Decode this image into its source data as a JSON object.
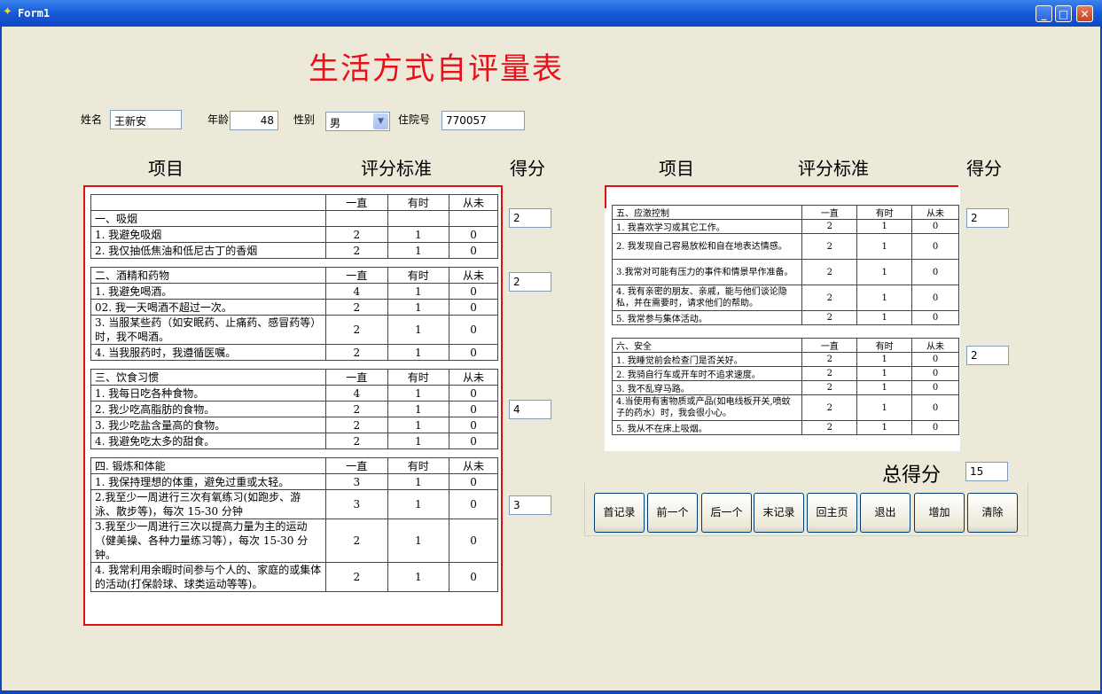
{
  "window": {
    "title": "Form1"
  },
  "form": {
    "heading": "生活方式自评量表",
    "name_label": "姓名",
    "name_value": "王新安",
    "age_label": "年龄",
    "age_value": "48",
    "gender_label": "性别",
    "gender_value": "男",
    "admission_label": "住院号",
    "admission_value": "770057"
  },
  "columns": {
    "item": "项目",
    "criteria": "评分标准",
    "score": "得分"
  },
  "scale_headers": {
    "always": "一直",
    "sometimes": "有时",
    "never": "从未"
  },
  "sections_left": [
    {
      "title": "一、吸烟",
      "score": "2",
      "items": [
        {
          "text": "1. 我避免吸烟",
          "v": [
            "2",
            "1",
            "0"
          ]
        },
        {
          "text": "2. 我仅抽低焦油和低尼古丁的香烟",
          "v": [
            "2",
            "1",
            "0"
          ]
        }
      ]
    },
    {
      "title": "二、酒精和药物",
      "score": "2",
      "items": [
        {
          "text": "1. 我避免喝酒。",
          "v": [
            "4",
            "1",
            "0"
          ]
        },
        {
          "text": "02. 我一天喝酒不超过一次。",
          "v": [
            "2",
            "1",
            "0"
          ]
        },
        {
          "text": "3. 当服某些药（如安眠药、止痛药、感冒药等）时，我不喝酒。",
          "v": [
            "2",
            "1",
            "0"
          ]
        },
        {
          "text": "4. 当我服药时，我遵循医嘱。",
          "v": [
            "2",
            "1",
            "0"
          ]
        }
      ]
    },
    {
      "title": "三、饮食习惯",
      "score": "4",
      "items": [
        {
          "text": "1. 我每日吃各种食物。",
          "v": [
            "4",
            "1",
            "0"
          ]
        },
        {
          "text": "2. 我少吃高脂肪的食物。",
          "v": [
            "2",
            "1",
            "0"
          ]
        },
        {
          "text": "3. 我少吃盐含量高的食物。",
          "v": [
            "2",
            "1",
            "0"
          ]
        },
        {
          "text": "4. 我避免吃太多的甜食。",
          "v": [
            "2",
            "1",
            "0"
          ]
        }
      ]
    },
    {
      "title": "四. 锻炼和体能",
      "score": "3",
      "items": [
        {
          "text": "1. 我保持理想的体重，避免过重或太轻。",
          "v": [
            "3",
            "1",
            "0"
          ]
        },
        {
          "text": "2.我至少一周进行三次有氧练习(如跑步、游泳、散步等)，每次 15-30 分钟",
          "v": [
            "3",
            "1",
            "0"
          ]
        },
        {
          "text": "3.我至少一周进行三次以提高力量为主的运动（健美操、各种力量练习等），每次 15-30 分钟。",
          "v": [
            "2",
            "1",
            "0"
          ]
        },
        {
          "text": "4. 我常利用余暇时间参与个人的、家庭的或集体的活动(打保龄球、球类运动等等)。",
          "v": [
            "2",
            "1",
            "0"
          ]
        }
      ]
    }
  ],
  "sections_right": [
    {
      "title": "五、应激控制",
      "score": "2",
      "items": [
        {
          "text": "1. 我喜欢学习或其它工作。",
          "v": [
            "2",
            "1",
            "0"
          ]
        },
        {
          "text": "2. 我发现自己容易放松和自在地表达情感。",
          "v": [
            "2",
            "1",
            "0"
          ]
        },
        {
          "text": "3.我常对可能有压力的事件和情景早作准备。",
          "v": [
            "2",
            "1",
            "0"
          ]
        },
        {
          "text": "4. 我有亲密的朋友、亲戚，能与他们谈论隐私，并在需要时，请求他们的帮助。",
          "v": [
            "2",
            "1",
            "0"
          ]
        },
        {
          "text": "5. 我常参与集体活动。",
          "v": [
            "2",
            "1",
            "0"
          ]
        }
      ]
    },
    {
      "title": "六、安全",
      "score": "2",
      "items": [
        {
          "text": "1. 我睡觉前会检查门是否关好。",
          "v": [
            "2",
            "1",
            "0"
          ]
        },
        {
          "text": "2. 我骑自行车或开车时不追求速度。",
          "v": [
            "2",
            "1",
            "0"
          ]
        },
        {
          "text": "3. 我不乱穿马路。",
          "v": [
            "2",
            "1",
            "0"
          ]
        },
        {
          "text": "4.当使用有害物质或产品(如电线板开关,喷蚊子的药水）时，我会很小心。",
          "v": [
            "2",
            "1",
            "0"
          ]
        },
        {
          "text": "5. 我从不在床上吸烟。",
          "v": [
            "2",
            "1",
            "0"
          ]
        }
      ]
    }
  ],
  "total": {
    "label": "总得分",
    "value": "15"
  },
  "buttons": [
    "首记录",
    "前一个",
    "后一个",
    "末记录",
    "回主页",
    "退出",
    "增加",
    "清除"
  ]
}
